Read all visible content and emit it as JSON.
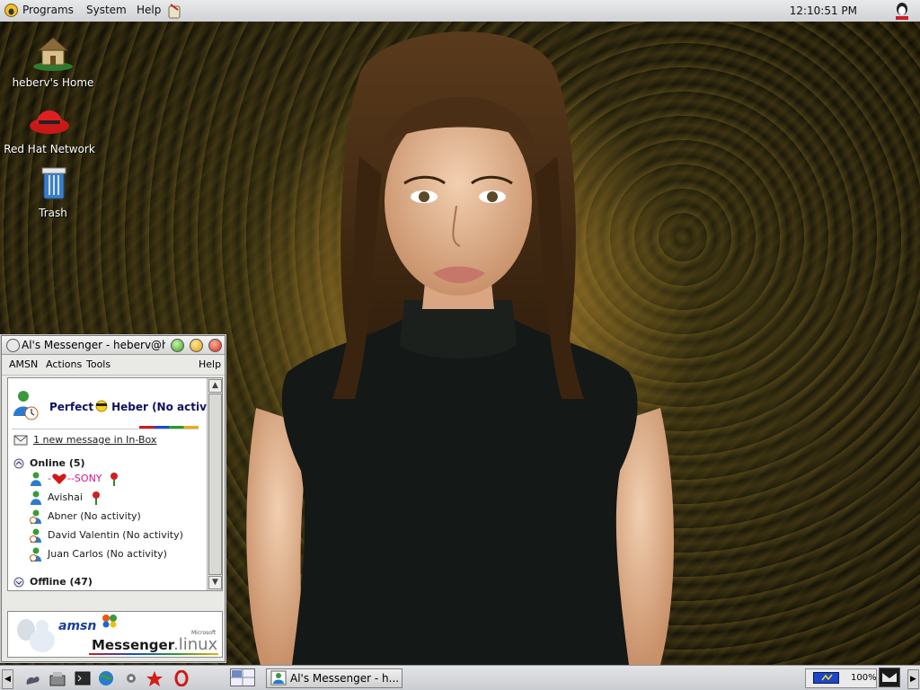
{
  "top_panel": {
    "menus": [
      "Programs",
      "System",
      "Help"
    ],
    "clock": "12:10:51 PM",
    "applet_icon": "amsn-status-icon"
  },
  "desktop": {
    "icons": [
      {
        "label": "heberv's Home",
        "icon": "home-icon"
      },
      {
        "label": "Red Hat Network",
        "icon": "redhat-icon"
      },
      {
        "label": "Trash",
        "icon": "trash-icon"
      }
    ]
  },
  "messenger": {
    "title": "Al's Messenger - heberv@h",
    "menus": [
      "AMSN",
      "Actions",
      "Tools"
    ],
    "help": "Help",
    "header": {
      "prefix": "Perfect",
      "suffix": "Heber (No activit"
    },
    "inbox": "1 new message in In-Box",
    "groups": {
      "online": "Online (5)",
      "offline": "Offline (47)"
    },
    "contacts": [
      {
        "name": "-",
        "extra": "--SONY",
        "status": "online"
      },
      {
        "name": "Avishai",
        "extra": "",
        "status": "online"
      },
      {
        "name": "Abner (No activity)",
        "extra": "",
        "status": "idle"
      },
      {
        "name": "David Valentin (No activity)",
        "extra": "",
        "status": "idle"
      },
      {
        "name": "Juan Carlos (No activity)",
        "extra": "",
        "status": "idle"
      }
    ],
    "footer": {
      "brand": "amsn",
      "product": "Messenger",
      "os": ".linux",
      "vendor": "Microsoft"
    }
  },
  "bottom_panel": {
    "task": "Al's Messenger - h...",
    "battery": "100%"
  },
  "colors": {
    "panel": "#d4d6da",
    "sony_pink": "#d1168c",
    "link": "#1a1a6a"
  }
}
